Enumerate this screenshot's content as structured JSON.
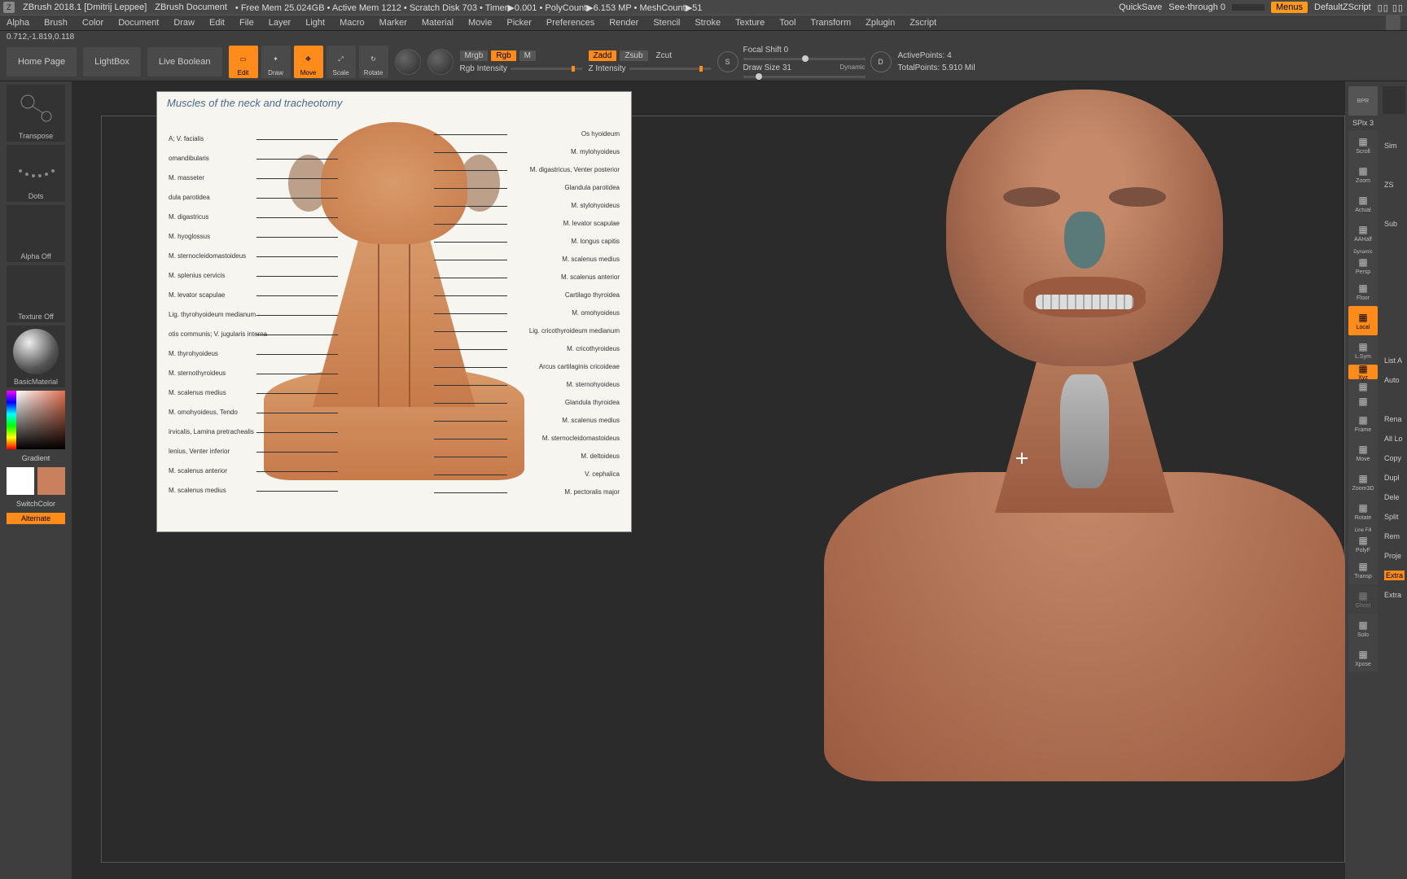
{
  "titlebar": {
    "app": "ZBrush 2018.1 [Dmitrij Leppee]",
    "doc": "ZBrush Document",
    "stats": "•  Free Mem 25.024GB • Active Mem 1212 • Scratch Disk 703 •  Timer▶0.001  • PolyCount▶6.153 MP  • MeshCount▶51",
    "quicksave": "QuickSave",
    "seethrough": "See-through  0",
    "menus": "Menus",
    "defaultscript": "DefaultZScript"
  },
  "menubar": [
    "Alpha",
    "Brush",
    "Color",
    "Document",
    "Draw",
    "Edit",
    "File",
    "Layer",
    "Light",
    "Macro",
    "Marker",
    "Material",
    "Movie",
    "Picker",
    "Preferences",
    "Render",
    "Stencil",
    "Stroke",
    "Texture",
    "Tool",
    "Transform",
    "Zplugin",
    "Zscript"
  ],
  "coords": "0.712,-1.819,0.118",
  "shelf": {
    "home": "Home Page",
    "lightbox": "LightBox",
    "liveboolean": "Live Boolean",
    "tools": [
      {
        "label": "Edit",
        "active": true
      },
      {
        "label": "Draw",
        "active": false
      },
      {
        "label": "Move",
        "active": true
      },
      {
        "label": "Scale",
        "active": false
      },
      {
        "label": "Rotate",
        "active": false
      }
    ],
    "mrgb": {
      "mrgb": "Mrgb",
      "rgb": "Rgb",
      "m": "M",
      "label": "Rgb Intensity"
    },
    "zadd": {
      "zadd": "Zadd",
      "zsub": "Zsub",
      "zcut": "Zcut",
      "label": "Z Intensity"
    },
    "focal": {
      "label": "Focal Shift",
      "value": "0"
    },
    "draw": {
      "label": "Draw Size",
      "value": "31",
      "dynamic": "Dynamic"
    },
    "points": {
      "active": "ActivePoints: 4",
      "total": "TotalPoints: 5.910 Mil"
    }
  },
  "left": {
    "transpose": "Transpose",
    "dots": "Dots",
    "alphaoff": "Alpha Off",
    "textureoff": "Texture Off",
    "material": "BasicMaterial",
    "gradient": "Gradient",
    "switchcolor": "SwitchColor",
    "alternate": "Alternate",
    "swatch1": "#ffffff",
    "swatch2": "#c9805c"
  },
  "reference": {
    "title": "Muscles of the neck and tracheotomy",
    "labels_left": [
      "A; V. facialis",
      "omandibularis",
      "M. masseter",
      "dula parotidea",
      "M. digastricus",
      "M. hyoglossus",
      "M. sternocleidomastoideus",
      "M. splenius cervicis",
      "M. levator scapulae",
      "Lig. thyrohyoideum medianum",
      "otis communis; V. jugularis interna",
      "M. thyrohyoideus",
      "M. sternothyroideus",
      "M. scalenus medius",
      "M. omohyoideus, Tendo",
      "irvicalis, Lamina pretrachealis",
      "lenius, Venter inferior",
      "M. scalenus anterior",
      "M. scalenus medius"
    ],
    "labels_right": [
      "Os hyoideum",
      "M. mylohyoideus",
      "M. digastricus, Venter posterior",
      "Glandula parotidea",
      "M. stylohyoideus",
      "M. levator scapulae",
      "M. longus capitis",
      "M. scalenus medius",
      "M. scalenus anterior",
      "Cartilago thyroidea",
      "M. omohyoideus",
      "Lig. cricothyroideum medianum",
      "M. cricothyroideus",
      "Arcus cartilaginis cricoideae",
      "M. sternohyoideus",
      "Glandula thyroidea",
      "M. scalenus medius",
      "M. sternocleidomastoideus",
      "M. deltoideus",
      "V. cephalica",
      "M. pectoralis major"
    ]
  },
  "right_strip": {
    "bpr": "BPR",
    "sim": "Sim",
    "spix": "SPix 3",
    "buttons": [
      {
        "n": "Scroll",
        "o": false
      },
      {
        "n": "Zoom",
        "o": false
      },
      {
        "n": "Actual",
        "o": false
      },
      {
        "n": "AAHalf",
        "o": false
      },
      {
        "n": "Persp",
        "o": false,
        "extra": "Dynamic"
      },
      {
        "n": "Floor",
        "o": false
      },
      {
        "n": "Local",
        "o": true
      },
      {
        "n": "L.Sym",
        "o": false
      },
      {
        "n": "Xyz",
        "o": true,
        "thin": true
      },
      {
        "n": "",
        "o": false,
        "thin": true
      },
      {
        "n": "",
        "o": false,
        "thin": true
      },
      {
        "n": "Frame",
        "o": false
      },
      {
        "n": "Move",
        "o": false
      },
      {
        "n": "Zoom3D",
        "o": false
      },
      {
        "n": "Rotate",
        "o": false
      },
      {
        "n": "PolyF",
        "o": false,
        "extra": "Line Fill"
      },
      {
        "n": "Transp",
        "o": false
      },
      {
        "n": "Ghost",
        "o": false,
        "dim": true
      },
      {
        "n": "Solo",
        "o": false
      },
      {
        "n": "Xpose",
        "o": false
      }
    ]
  },
  "far_right": {
    "rows": [
      "",
      "Sim",
      "",
      "ZS",
      "",
      "Sub",
      "",
      "",
      "",
      "",
      "",
      "",
      "List A",
      "Auto",
      "",
      "Rena",
      "All Lo",
      "Copy",
      "Dupl",
      "Dele",
      "Split",
      "Rem",
      "Proje",
      "Extra",
      "Extra"
    ]
  }
}
